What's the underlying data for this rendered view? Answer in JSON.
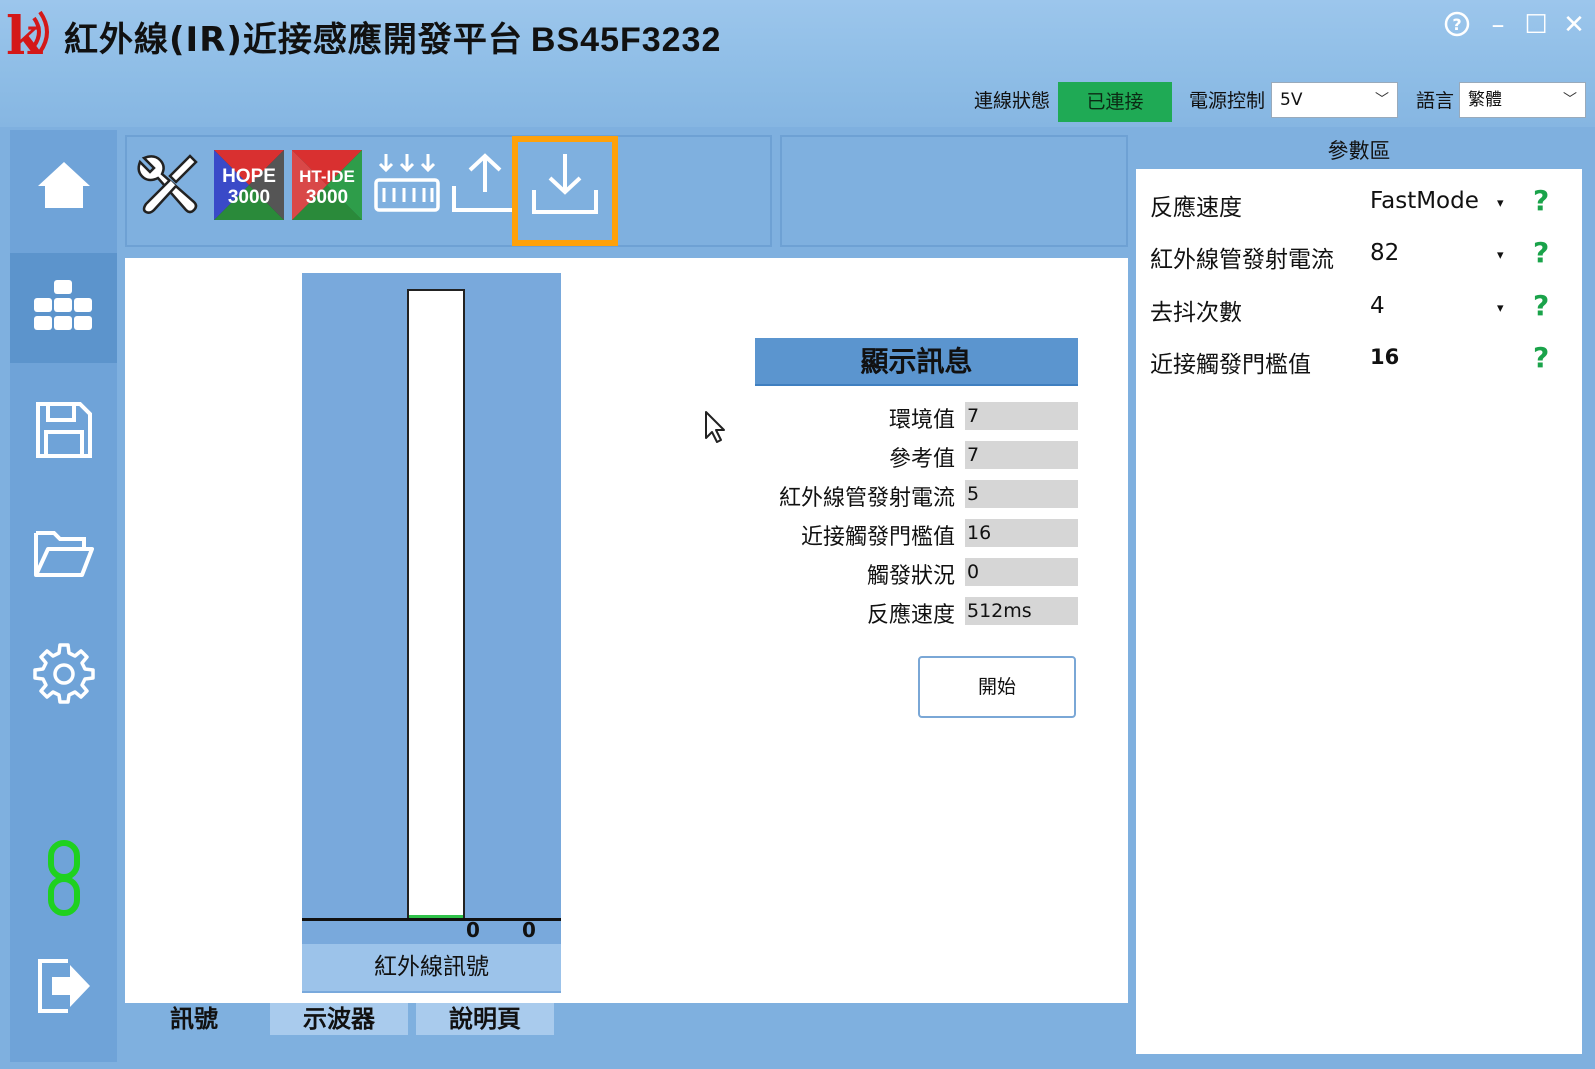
{
  "window": {
    "title": "紅外線(IR)近接感應開發平台",
    "model": "BS45F3232",
    "help": "?",
    "minimize": "–",
    "maximize": "☐",
    "close": "✕"
  },
  "status": {
    "conn_label": "連線狀態",
    "conn_value": "已連接",
    "power_label": "電源控制",
    "power_value": "5V",
    "lang_label": "語言",
    "lang_value": "繁體",
    "conn_color": "#1faa55"
  },
  "nav": [
    "home-icon",
    "modules-icon",
    "save-icon",
    "folder-open-icon",
    "gear-icon",
    "link-icon",
    "exit-icon"
  ],
  "toolbar": {
    "hope_line1": "HOPE",
    "hope_line2": "3000",
    "htide_line1": "HT-IDE",
    "htide_line2": "3000"
  },
  "gauge": {
    "value_left": "0",
    "value_right": "0",
    "label": "紅外線訊號",
    "level": 0
  },
  "info": {
    "header": "顯示訊息",
    "rows": [
      {
        "label": "環境值",
        "value": "7"
      },
      {
        "label": "參考值",
        "value": "7"
      },
      {
        "label": "紅外線管發射電流",
        "value": "5"
      },
      {
        "label": "近接觸發門檻值",
        "value": "16"
      },
      {
        "label": "觸發狀況",
        "value": "0"
      },
      {
        "label": "反應速度",
        "value": "512ms"
      }
    ],
    "start_button": "開始"
  },
  "tabs": [
    "訊號",
    "示波器",
    "說明頁"
  ],
  "params": {
    "header": "參數區",
    "rows": [
      {
        "label": "反應速度",
        "value": "FastMode"
      },
      {
        "label": "紅外線管發射電流",
        "value": "82"
      },
      {
        "label": "去抖次數",
        "value": "4"
      },
      {
        "label": "近接觸發門檻值",
        "value": "16"
      }
    ],
    "help_symbol": "?",
    "dropdown_symbol": "▾"
  },
  "colors": {
    "accent": "#ffa10a",
    "help": "#1aa34a",
    "panel": "#7fb0df"
  }
}
